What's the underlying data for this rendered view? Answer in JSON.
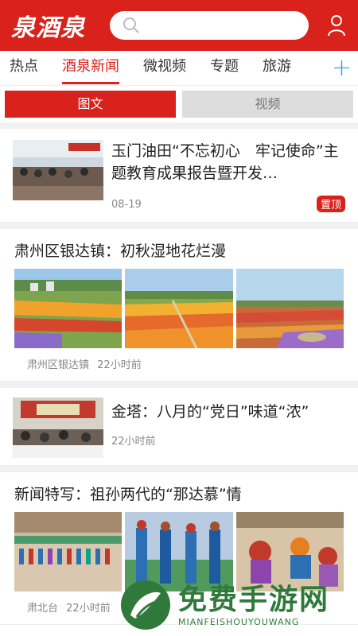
{
  "app": {
    "logo_text": "泉酒泉",
    "search_placeholder": ""
  },
  "tabs": [
    {
      "label": "热点"
    },
    {
      "label": "酒泉新闻"
    },
    {
      "label": "微视频"
    },
    {
      "label": "专题"
    },
    {
      "label": "旅游"
    }
  ],
  "tab_add_label": "+",
  "segments": {
    "picture_text": "图文",
    "video": "视频"
  },
  "news": [
    {
      "title": "玉门油田“不忘初心　牢记使命”主题教育成果报告暨开发…",
      "date": "08-19",
      "badge": "置顶"
    }
  ],
  "gallery1": {
    "title": "肃州区银达镇：初秋湿地花烂漫",
    "source": "肃州区银达镇",
    "time": "22小时前"
  },
  "news2": {
    "title": "金塔：八月的“党日”味道“浓”",
    "time": "22小时前"
  },
  "gallery2": {
    "title": "新闻特写：祖孙两代的“那达慕”情",
    "source": "肃北台",
    "time": "22小时前"
  },
  "watermark": {
    "cn": "免费手游网",
    "en": "MIANFEISHOUYOUWANG"
  },
  "colors": {
    "brand_red": "#d8221b",
    "accent_blue": "#36a3e0"
  }
}
